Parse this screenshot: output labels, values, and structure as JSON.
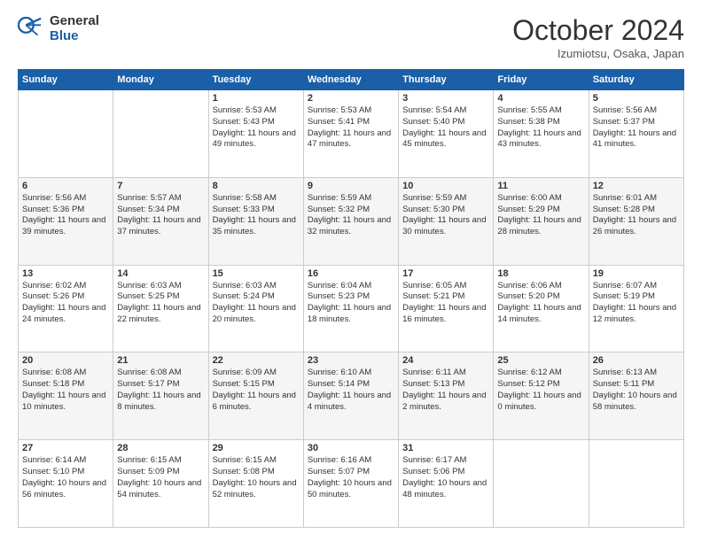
{
  "logo": {
    "general": "General",
    "blue": "Blue"
  },
  "title": "October 2024",
  "location": "Izumiotsu, Osaka, Japan",
  "days_of_week": [
    "Sunday",
    "Monday",
    "Tuesday",
    "Wednesday",
    "Thursday",
    "Friday",
    "Saturday"
  ],
  "weeks": [
    [
      {
        "day": null,
        "info": ""
      },
      {
        "day": null,
        "info": ""
      },
      {
        "day": "1",
        "sunrise": "5:53 AM",
        "sunset": "5:43 PM",
        "daylight": "11 hours and 49 minutes."
      },
      {
        "day": "2",
        "sunrise": "5:53 AM",
        "sunset": "5:41 PM",
        "daylight": "11 hours and 47 minutes."
      },
      {
        "day": "3",
        "sunrise": "5:54 AM",
        "sunset": "5:40 PM",
        "daylight": "11 hours and 45 minutes."
      },
      {
        "day": "4",
        "sunrise": "5:55 AM",
        "sunset": "5:38 PM",
        "daylight": "11 hours and 43 minutes."
      },
      {
        "day": "5",
        "sunrise": "5:56 AM",
        "sunset": "5:37 PM",
        "daylight": "11 hours and 41 minutes."
      }
    ],
    [
      {
        "day": "6",
        "sunrise": "5:56 AM",
        "sunset": "5:36 PM",
        "daylight": "11 hours and 39 minutes."
      },
      {
        "day": "7",
        "sunrise": "5:57 AM",
        "sunset": "5:34 PM",
        "daylight": "11 hours and 37 minutes."
      },
      {
        "day": "8",
        "sunrise": "5:58 AM",
        "sunset": "5:33 PM",
        "daylight": "11 hours and 35 minutes."
      },
      {
        "day": "9",
        "sunrise": "5:59 AM",
        "sunset": "5:32 PM",
        "daylight": "11 hours and 32 minutes."
      },
      {
        "day": "10",
        "sunrise": "5:59 AM",
        "sunset": "5:30 PM",
        "daylight": "11 hours and 30 minutes."
      },
      {
        "day": "11",
        "sunrise": "6:00 AM",
        "sunset": "5:29 PM",
        "daylight": "11 hours and 28 minutes."
      },
      {
        "day": "12",
        "sunrise": "6:01 AM",
        "sunset": "5:28 PM",
        "daylight": "11 hours and 26 minutes."
      }
    ],
    [
      {
        "day": "13",
        "sunrise": "6:02 AM",
        "sunset": "5:26 PM",
        "daylight": "11 hours and 24 minutes."
      },
      {
        "day": "14",
        "sunrise": "6:03 AM",
        "sunset": "5:25 PM",
        "daylight": "11 hours and 22 minutes."
      },
      {
        "day": "15",
        "sunrise": "6:03 AM",
        "sunset": "5:24 PM",
        "daylight": "11 hours and 20 minutes."
      },
      {
        "day": "16",
        "sunrise": "6:04 AM",
        "sunset": "5:23 PM",
        "daylight": "11 hours and 18 minutes."
      },
      {
        "day": "17",
        "sunrise": "6:05 AM",
        "sunset": "5:21 PM",
        "daylight": "11 hours and 16 minutes."
      },
      {
        "day": "18",
        "sunrise": "6:06 AM",
        "sunset": "5:20 PM",
        "daylight": "11 hours and 14 minutes."
      },
      {
        "day": "19",
        "sunrise": "6:07 AM",
        "sunset": "5:19 PM",
        "daylight": "11 hours and 12 minutes."
      }
    ],
    [
      {
        "day": "20",
        "sunrise": "6:08 AM",
        "sunset": "5:18 PM",
        "daylight": "11 hours and 10 minutes."
      },
      {
        "day": "21",
        "sunrise": "6:08 AM",
        "sunset": "5:17 PM",
        "daylight": "11 hours and 8 minutes."
      },
      {
        "day": "22",
        "sunrise": "6:09 AM",
        "sunset": "5:15 PM",
        "daylight": "11 hours and 6 minutes."
      },
      {
        "day": "23",
        "sunrise": "6:10 AM",
        "sunset": "5:14 PM",
        "daylight": "11 hours and 4 minutes."
      },
      {
        "day": "24",
        "sunrise": "6:11 AM",
        "sunset": "5:13 PM",
        "daylight": "11 hours and 2 minutes."
      },
      {
        "day": "25",
        "sunrise": "6:12 AM",
        "sunset": "5:12 PM",
        "daylight": "11 hours and 0 minutes."
      },
      {
        "day": "26",
        "sunrise": "6:13 AM",
        "sunset": "5:11 PM",
        "daylight": "10 hours and 58 minutes."
      }
    ],
    [
      {
        "day": "27",
        "sunrise": "6:14 AM",
        "sunset": "5:10 PM",
        "daylight": "10 hours and 56 minutes."
      },
      {
        "day": "28",
        "sunrise": "6:15 AM",
        "sunset": "5:09 PM",
        "daylight": "10 hours and 54 minutes."
      },
      {
        "day": "29",
        "sunrise": "6:15 AM",
        "sunset": "5:08 PM",
        "daylight": "10 hours and 52 minutes."
      },
      {
        "day": "30",
        "sunrise": "6:16 AM",
        "sunset": "5:07 PM",
        "daylight": "10 hours and 50 minutes."
      },
      {
        "day": "31",
        "sunrise": "6:17 AM",
        "sunset": "5:06 PM",
        "daylight": "10 hours and 48 minutes."
      },
      {
        "day": null,
        "info": ""
      },
      {
        "day": null,
        "info": ""
      }
    ]
  ]
}
